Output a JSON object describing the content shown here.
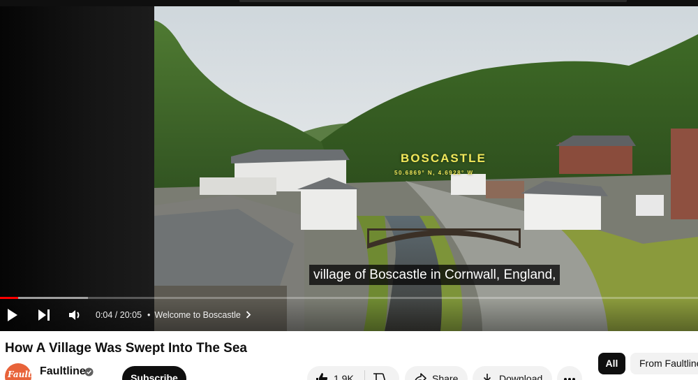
{
  "video": {
    "overlay_title": "BOSCASTLE",
    "overlay_coords": "50.6869° N, 4.6928° W",
    "caption": "village of Boscastle in Cornwall, England,"
  },
  "controls": {
    "time": "0:04 / 20:05",
    "chapter_separator": "•",
    "chapter": "Welcome to Boscastle",
    "progress_fraction": 0.002
  },
  "title": "How A Village Was Swept Into The Sea",
  "channel": {
    "avatar_text": "Fault",
    "name": "Faultline",
    "subscribe_label": "Subscribe"
  },
  "actions": {
    "like_count": "1.9K",
    "share_label": "Share",
    "download_label": "Download"
  },
  "chips": {
    "all": "All",
    "from": "From Faultline"
  },
  "colors": {
    "progress": "#ff0000",
    "overlay_text": "#f2e85a",
    "avatar": "#e8633a"
  }
}
